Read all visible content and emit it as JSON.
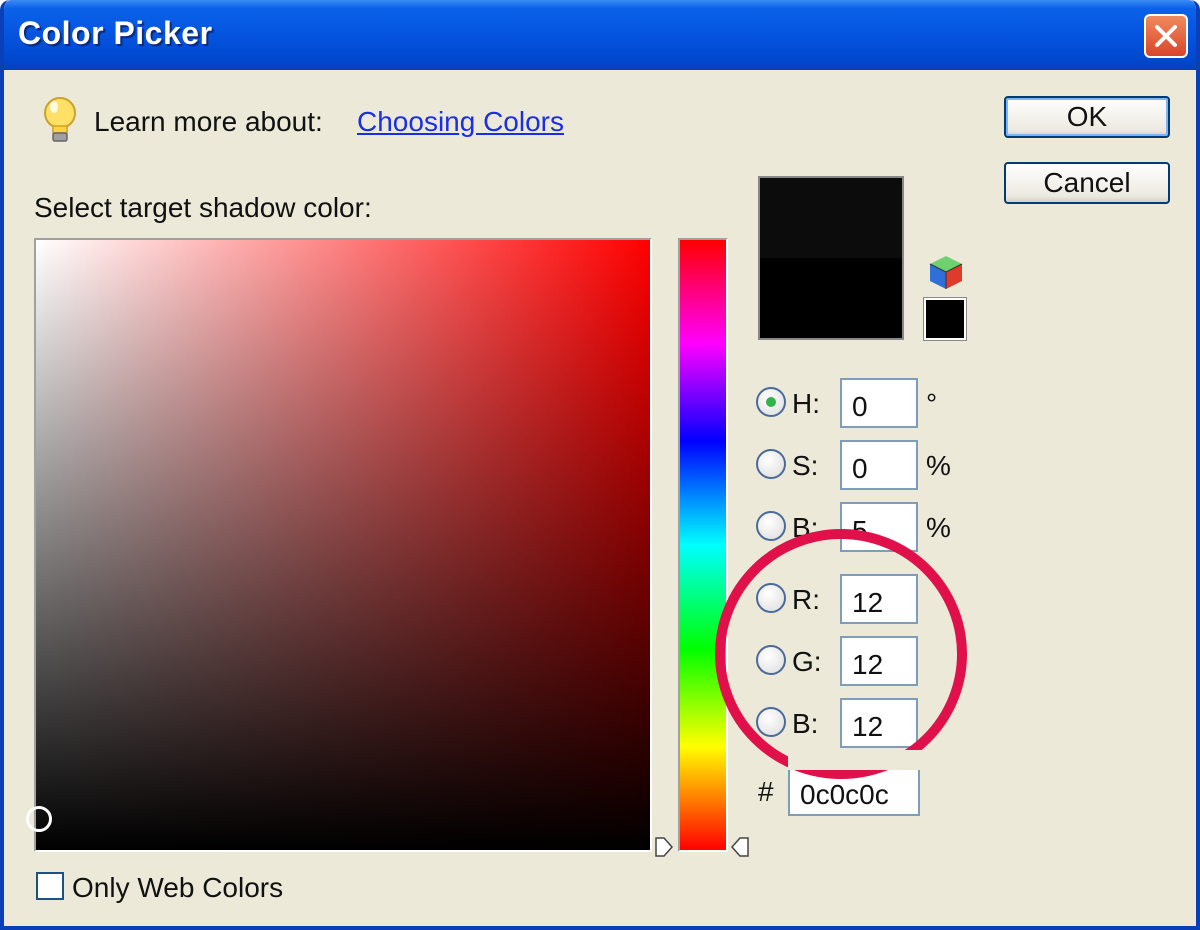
{
  "window": {
    "title": "Color Picker"
  },
  "tip": {
    "prefix": "Learn more about:",
    "link": "Choosing Colors"
  },
  "picker": {
    "label": "Select target shadow color:"
  },
  "buttons": {
    "ok": "OK",
    "cancel": "Cancel"
  },
  "swatch": {
    "new_color": "#0c0c0c",
    "current_color": "#000000"
  },
  "fields": [
    {
      "id": "h",
      "label": "H:",
      "value": "0",
      "unit": "°",
      "selected": true
    },
    {
      "id": "s",
      "label": "S:",
      "value": "0",
      "unit": "%",
      "selected": false
    },
    {
      "id": "b-brightness",
      "label": "B:",
      "value": "5",
      "unit": "%",
      "selected": false
    },
    {
      "id": "r",
      "label": "R:",
      "value": "12",
      "unit": "",
      "selected": false
    },
    {
      "id": "g",
      "label": "G:",
      "value": "12",
      "unit": "",
      "selected": false
    },
    {
      "id": "b-blue",
      "label": "B:",
      "value": "12",
      "unit": "",
      "selected": false
    }
  ],
  "hex": {
    "label": "#",
    "value": "0c0c0c"
  },
  "options": {
    "only_web_colors": "Only Web Colors"
  },
  "colors": {
    "annotation": "#e0114a",
    "titlebar": "#0554e0",
    "link": "#1a2eea",
    "radio_dot": "#2fb34a"
  },
  "icons": {
    "tip": "lightbulb-icon",
    "close": "close-icon",
    "gamut": "color-cube-icon"
  }
}
